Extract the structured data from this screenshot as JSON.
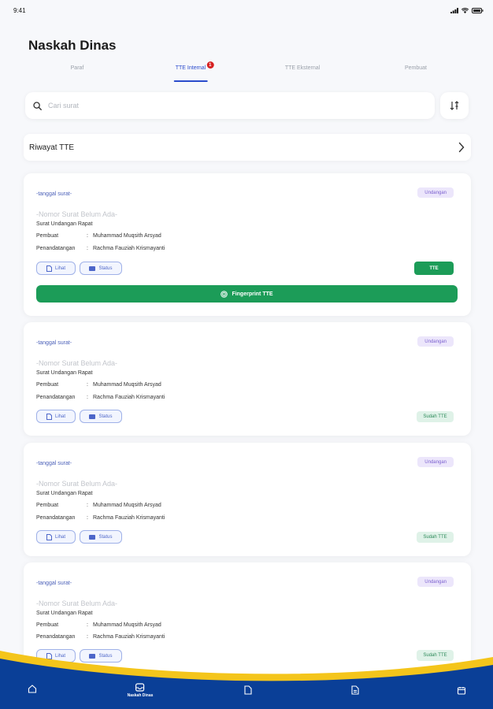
{
  "status_bar": {
    "time": "9:41"
  },
  "page_title": "Naskah Dinas",
  "tabs": [
    {
      "label": "Paraf"
    },
    {
      "label": "TTE Internal",
      "badge": "1",
      "active": true
    },
    {
      "label": "TTE Eksternal"
    },
    {
      "label": "Pembuat"
    }
  ],
  "search": {
    "placeholder": "Cari surat"
  },
  "riwayat": {
    "label": "Riwayat TTE"
  },
  "cards": [
    {
      "date": "-tanggal surat-",
      "tag": "Undangan",
      "nomor": "-Nomor Surat Belum Ada-",
      "subject": "Surat Undangan Rapat",
      "pembuat_label": "Pembuat",
      "pembuat": "Muhammad Muqsith Arsyad",
      "penandatangan_label": "Penandatangan",
      "penandatangan": "Rachma Fauziah Krismayanti",
      "lihat": "Lihat",
      "status": "Status",
      "chip": "TTE",
      "fingerprint": "Fingerprint TTE"
    },
    {
      "date": "-tanggal surat-",
      "tag": "Undangan",
      "nomor": "-Nomor Surat Belum Ada-",
      "subject": "Surat Undangan Rapat",
      "pembuat_label": "Pembuat",
      "pembuat": "Muhammad Muqsith Arsyad",
      "penandatangan_label": "Penandatangan",
      "penandatangan": "Rachma Fauziah Krismayanti",
      "lihat": "Lihat",
      "status": "Status",
      "chip": "Sudah TTE"
    },
    {
      "date": "-tanggal surat-",
      "tag": "Undangan",
      "nomor": "-Nomor Surat Belum Ada-",
      "subject": "Surat Undangan Rapat",
      "pembuat_label": "Pembuat",
      "pembuat": "Muhammad Muqsith Arsyad",
      "penandatangan_label": "Penandatangan",
      "penandatangan": "Rachma Fauziah Krismayanti",
      "lihat": "Lihat",
      "status": "Status",
      "chip": "Sudah TTE"
    },
    {
      "date": "-tanggal surat-",
      "tag": "Undangan",
      "nomor": "-Nomor Surat Belum Ada-",
      "subject": "Surat Undangan Rapat",
      "pembuat_label": "Pembuat",
      "pembuat": "Muhammad Muqsith Arsyad",
      "penandatangan_label": "Penandatangan",
      "penandatangan": "Rachma Fauziah Krismayanti",
      "lihat": "Lihat",
      "status": "Status",
      "chip": "Sudah TTE"
    }
  ],
  "bottom_nav": {
    "items": [
      {
        "icon": "home-icon"
      },
      {
        "icon": "inbox-icon",
        "label": "Naskah Dinas",
        "active": true
      },
      {
        "icon": "file-icon"
      },
      {
        "icon": "document-icon"
      },
      {
        "icon": "calendar-icon"
      }
    ]
  },
  "colors": {
    "primary": "#2a4bcc",
    "green": "#1c9c58",
    "nav_blue": "#0a3f97",
    "nav_yellow": "#f4c51b",
    "badge_red": "#d62020"
  }
}
